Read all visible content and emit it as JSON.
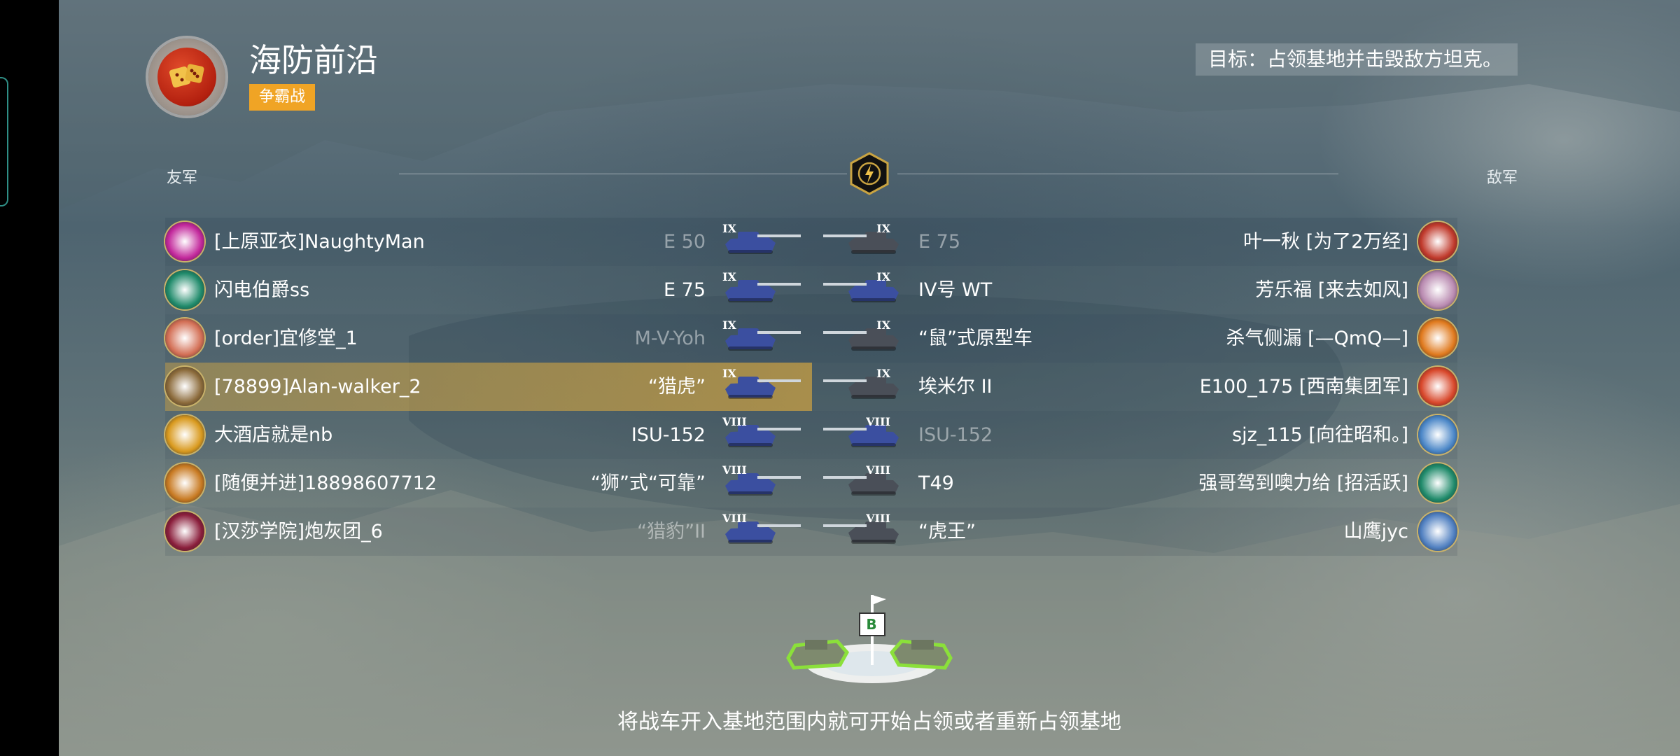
{
  "header": {
    "map_name": "海防前沿",
    "mode_badge": "争霸战",
    "objective": "目标：占领基地并击毁敌方坦克。"
  },
  "teams": {
    "ally_label": "友军",
    "enemy_label": "敌军"
  },
  "allies": [
    {
      "player": "[上原亚衣]NaughtyMan",
      "tank": "E 50",
      "tier": "IX",
      "tank_dim": true,
      "avatar_color": "#c2279b",
      "self": false
    },
    {
      "player": "闪电伯爵ss",
      "tank": "E 75",
      "tier": "IX",
      "tank_dim": false,
      "avatar_color": "#1f8a6a",
      "self": false
    },
    {
      "player": "[order]宜修堂_1",
      "tank": "M-V-Yoh",
      "tier": "IX",
      "tank_dim": true,
      "avatar_color": "#d36f55",
      "self": false
    },
    {
      "player": "[78899]Alan-walker_2",
      "tank": "“猎虎”",
      "tier": "IX",
      "tank_dim": false,
      "avatar_color": "#8b6a3a",
      "self": true
    },
    {
      "player": "大酒店就是nb",
      "tank": "ISU-152",
      "tier": "VIII",
      "tank_dim": false,
      "avatar_color": "#d99a1f",
      "self": false
    },
    {
      "player": "[随便并进]18898607712",
      "tank": "“狮”式“可靠”",
      "tier": "VIII",
      "tank_dim": false,
      "avatar_color": "#c87a22",
      "self": false
    },
    {
      "player": "[汉莎学院]炮灰团_6",
      "tank": "“猎豹”II",
      "tier": "VIII",
      "tank_dim": true,
      "avatar_color": "#8a1e3b",
      "self": false
    }
  ],
  "enemies": [
    {
      "player": "叶一秋 [为了2万经]",
      "tank": "E 75",
      "tier": "IX",
      "tank_dim": true,
      "avatar_color": "#c0392b"
    },
    {
      "player": "芳乐福 [来去如风]",
      "tank": "IV号 WT",
      "tier": "IX",
      "tank_dim": false,
      "avatar_color": "#b98ab0"
    },
    {
      "player": "杀气侧漏 [—QmQ—]",
      "tank": "“鼠”式原型车",
      "tier": "IX",
      "tank_dim": false,
      "avatar_color": "#e07a1e"
    },
    {
      "player": "E100_175 [西南集团军]",
      "tank": "埃米尔 II",
      "tier": "IX",
      "tank_dim": false,
      "avatar_color": "#d8472a"
    },
    {
      "player": "sjz_115 [向往昭和。]",
      "tank": "ISU-152",
      "tier": "VIII",
      "tank_dim": true,
      "avatar_color": "#4a86c7"
    },
    {
      "player": "强哥驾到噢力给 [招活跃]",
      "tank": "T49",
      "tier": "VIII",
      "tank_dim": false,
      "avatar_color": "#1f8a6a"
    },
    {
      "player": "山鹰jyc",
      "tank": "“虎王”",
      "tier": "VIII",
      "tank_dim": false,
      "avatar_color": "#4f7fc0"
    }
  ],
  "capture_point_letter": "B",
  "hint": "将战车开入基地范围内就可开始占领或者重新占领基地",
  "colors": {
    "mode_badge": "#f0a425",
    "self_row": "#b8964a",
    "ally_tank": "#3b4fa0",
    "enemy_tank": "#4a4f58"
  }
}
